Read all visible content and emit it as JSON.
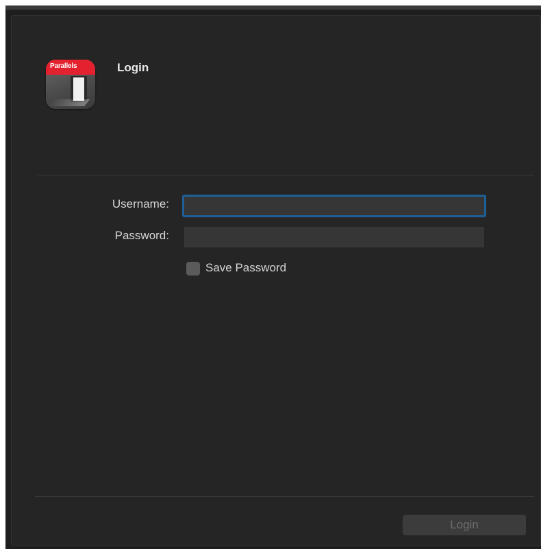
{
  "window": {
    "title": "Login"
  },
  "app_icon": {
    "name": "parallels-icon",
    "brand_text": "Parallels",
    "accent_color": "#e4212f"
  },
  "form": {
    "username_label": "Username:",
    "username_value": "",
    "password_label": "Password:",
    "password_value": "",
    "save_password_label": "Save Password",
    "save_password_checked": false
  },
  "footer": {
    "login_button_label": "Login",
    "login_button_enabled": false
  },
  "colors": {
    "background": "#252525",
    "focus_ring": "#1f5f97",
    "input_background": "#363636"
  }
}
